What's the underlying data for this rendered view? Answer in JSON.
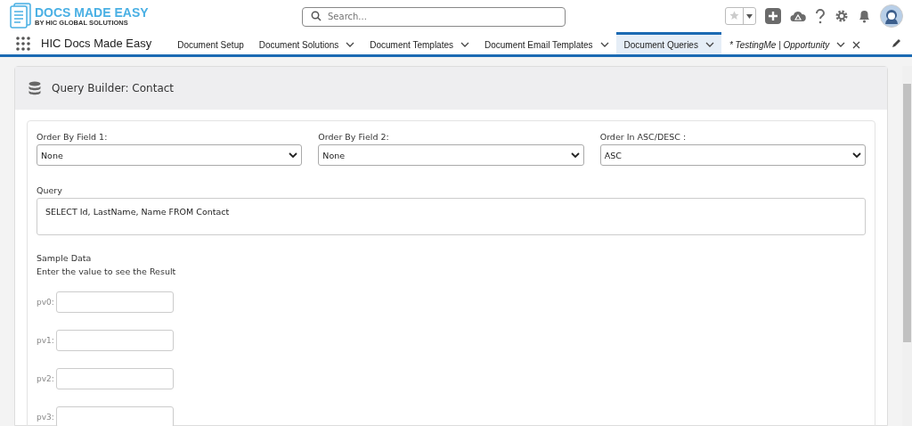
{
  "logo": {
    "title": "DOCS MADE EASY",
    "subtitle": "BY HIC GLOBAL SOLUTIONS"
  },
  "search": {
    "placeholder": "Search..."
  },
  "app_name": "HIC Docs Made Easy",
  "tabs": [
    {
      "label": "Document Setup",
      "kind": "nav",
      "selected": false,
      "menu": false
    },
    {
      "label": "Document Solutions",
      "kind": "nav",
      "selected": false,
      "menu": true
    },
    {
      "label": "Document Templates",
      "kind": "nav",
      "selected": false,
      "menu": true
    },
    {
      "label": "Document Email Templates",
      "kind": "nav",
      "selected": false,
      "menu": true
    },
    {
      "label": "Document Queries",
      "kind": "nav",
      "selected": true,
      "menu": true
    },
    {
      "label": "* TestingMe | Opportunity",
      "kind": "record",
      "selected": false,
      "menu": true
    }
  ],
  "card": {
    "title": "Query Builder: Contact",
    "selects": [
      {
        "label": "Order By Field 1:",
        "value": "None"
      },
      {
        "label": "Order By Field 2:",
        "value": "None"
      },
      {
        "label": "Order In ASC/DESC :",
        "value": "ASC"
      }
    ],
    "query": {
      "label": "Query",
      "value": "SELECT Id, LastName, Name  FROM Contact"
    },
    "sample_title": "Sample Data",
    "sample_hint": "Enter the value to see the Result",
    "params": [
      {
        "label": "pv0:"
      },
      {
        "label": "pv1:"
      },
      {
        "label": "pv2:"
      },
      {
        "label": "pv3:"
      }
    ]
  }
}
